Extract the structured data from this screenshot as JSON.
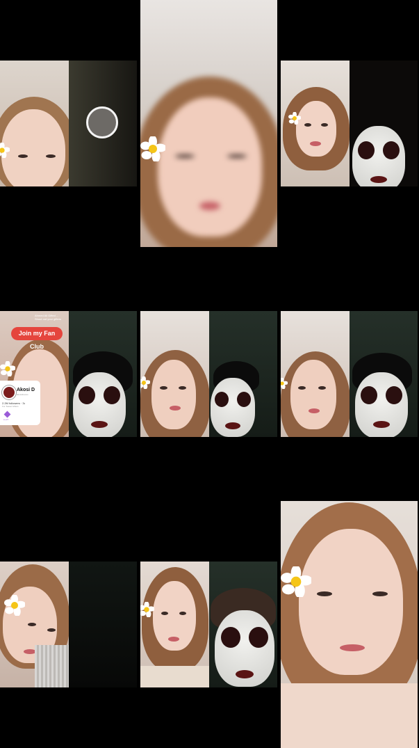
{
  "tiles": {
    "t4": {
      "fanclub_button": "Join my Fan Club",
      "top_line_1": "Ahmed Ali Gifted ...",
      "top_line_2": "Shout out your gifters",
      "profile_card": {
        "name": "Akosi D",
        "handle": "akosidnexus",
        "stats": "2.2M followers · 3•",
        "subtext": "For Teasel Gifters",
        "level": "Lv.27"
      }
    }
  },
  "colors": {
    "background": "#000000",
    "accent": "#e5453d",
    "gem": "#9a5bd8"
  },
  "icons": [
    "plumeria-flower-icon",
    "white-face-mask-icon",
    "gem-icon",
    "avatar-icon"
  ]
}
